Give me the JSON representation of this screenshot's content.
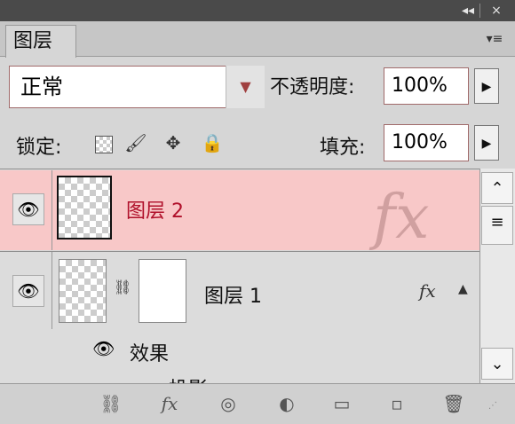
{
  "panel": {
    "tab_title": "图层",
    "menu_icon": "panel-menu-icon"
  },
  "titlebar": {
    "collapse_label": "◂◂",
    "close_label": "×"
  },
  "blend": {
    "mode": "正常"
  },
  "opacity": {
    "label": "不透明度:",
    "value": "100%"
  },
  "lock": {
    "label": "锁定:"
  },
  "fill": {
    "label": "填充:",
    "value": "100%"
  },
  "layers": [
    {
      "name": "图层 2",
      "selected": true,
      "fx_badge": "fx"
    },
    {
      "name": "图层 1",
      "selected": false,
      "fx_badge": "fx",
      "fx_expand": "▲"
    }
  ],
  "effects": {
    "label": "效果",
    "child_label": "投影"
  },
  "colors": {
    "selected_row": "#f8c8c8",
    "selected_text": "#b0102a",
    "accent_border": "#a06a6a"
  }
}
